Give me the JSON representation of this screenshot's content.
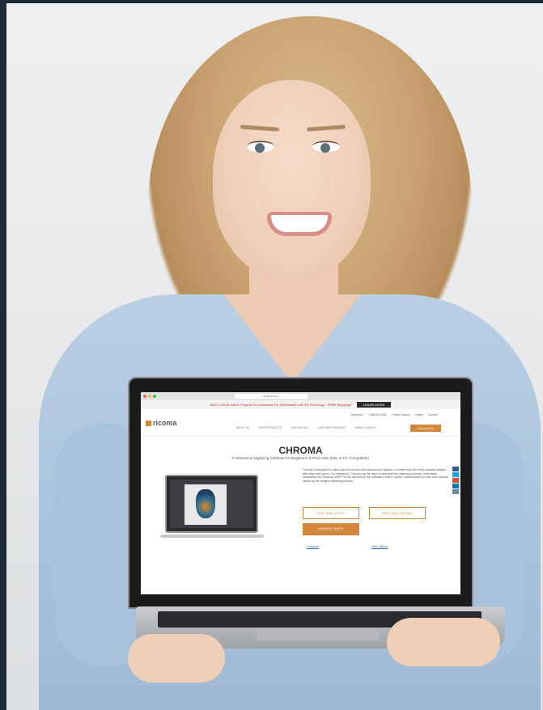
{
  "browser": {
    "url": "dr.ricoma.com"
  },
  "promo_bar": {
    "text": "MULTI-HEAD SALE: Expand Your Business For $283/month with 0% Financing + FREE Shipping!*",
    "button": "LEARN MORE"
  },
  "header": {
    "logo": "ricoma",
    "top_links": [
      "Questions?",
      "1-888-292-6282",
      "Contact Support",
      "English",
      "Español"
    ],
    "menu": [
      "ABOUT US",
      "SHOP PRODUCTS",
      "RESOURCES",
      "CUSTOMER SUCCESS",
      "NEWS & EVENTS"
    ],
    "contact_button": "Contact Us"
  },
  "hero": {
    "title": "CHROMA",
    "subtitle": "Professional Digitizing Software for Beginners & Pros Alike (Mac & PC Compatible)"
  },
  "content": {
    "description": "Chroma is designed to allow both the novice and experienced digitizer to create even the most intricate designs with ease and speed. For beginners, Chroma can be used to automate the digitizing process, essentially eliminating the learning curve. For the advanced, the software's built-in styles, customization of tools and hotkeys speed up the lengthy digitizing process.",
    "buttons": {
      "trial_pc": "FREE TRIAL FOR PC",
      "trial_mac": "FREE TRIAL FOR MAC",
      "quote": "REQUEST QUOTE"
    },
    "links": {
      "compare": "Compare",
      "gallery": "View Gallery"
    }
  },
  "colors": {
    "accent": "#d2873d",
    "promo_red": "#c1272d",
    "shirt": "#a9c2dc",
    "background": "#1f2a37"
  },
  "icons": {
    "social": [
      "facebook-icon",
      "twitter-icon",
      "google-plus-icon",
      "linkedin-icon",
      "email-icon"
    ]
  }
}
